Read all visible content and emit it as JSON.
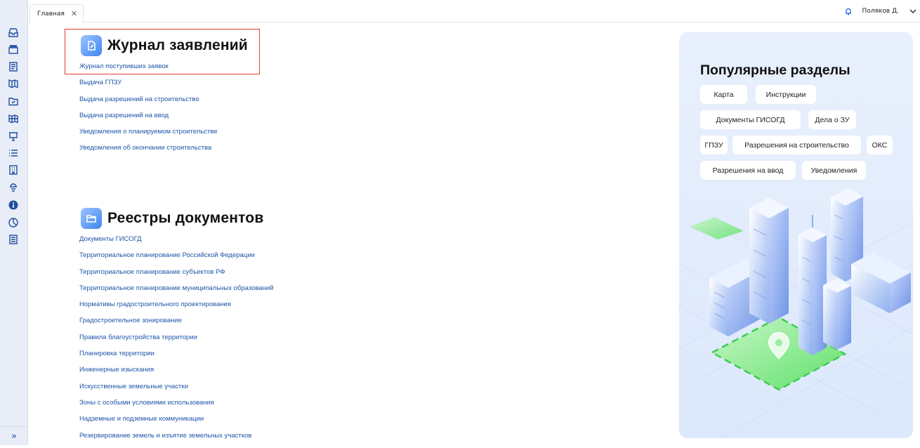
{
  "tabs": [
    {
      "label": "Главная"
    }
  ],
  "user": {
    "name": "Поляков Д."
  },
  "journal": {
    "title": "Журнал заявлений",
    "links": [
      "Журнал поступивших заявок",
      "Выдача ГПЗУ",
      "Выдача разрешений на строительство",
      "Выдача разрешений на ввод",
      "Уведомления о планируемом строительстве",
      "Уведомления об окончании строительства"
    ]
  },
  "registries": {
    "title": "Реестры документов",
    "links": [
      "Документы ГИСОГД",
      "Территориальное планирование Российской Федерации",
      "Территориальное планирование субъектов РФ",
      "Территориальное планирование муниципальных образований",
      "Нормативы градостроительного проектирования",
      "Градостроительное зонирование",
      "Правила благоустройства территории",
      "Планировка территории",
      "Инженерные изыскания",
      "Искусственные земельные участки",
      "Зоны с особыми условиями использования",
      "Надземные и подземные коммуникации",
      "Резервирование земель и изъятие земельных участков"
    ]
  },
  "popular": {
    "title": "Популярные разделы",
    "chips": [
      "Карта",
      "Инструкции",
      "Документы ГИСОГД",
      "Дела о ЗУ",
      "ГПЗУ",
      "Разрешения на строительство",
      "ОКС",
      "Разрешения на ввод",
      "Уведомления"
    ]
  },
  "colors": {
    "accent": "#1e55a8",
    "highlight": "#e53935",
    "sidebar": "#e8edf8"
  }
}
